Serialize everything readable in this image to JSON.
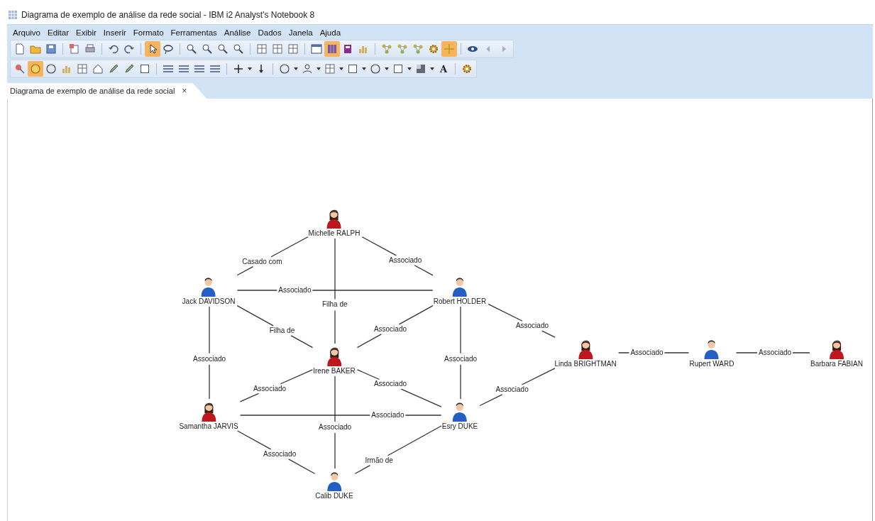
{
  "window": {
    "title": "Diagrama de exemplo de análise da rede social - IBM i2 Analyst's Notebook 8"
  },
  "menu": [
    "Arquivo",
    "Editar",
    "Exibir",
    "Inserir",
    "Formato",
    "Ferramentas",
    "Análise",
    "Dados",
    "Janela",
    "Ajuda"
  ],
  "toolbar_1": [
    {
      "selected": false
    },
    {
      "selected": false
    },
    {
      "selected": false
    },
    {
      "selected": false
    },
    {
      "selected": false
    },
    {
      "selected": false
    },
    {
      "selected": false
    },
    {
      "selected": true
    },
    {
      "selected": false
    },
    {
      "selected": false
    },
    {
      "selected": false
    },
    {
      "selected": false
    },
    {
      "selected": false
    },
    {
      "selected": false
    },
    {
      "selected": false
    },
    {
      "selected": false
    },
    {
      "selected": false
    },
    {
      "selected": true
    },
    {
      "selected": false
    },
    {
      "selected": false
    },
    {
      "selected": false
    },
    {
      "selected": false
    },
    {
      "selected": false
    },
    {
      "selected": false
    },
    {
      "selected": true
    },
    {
      "selected": false
    },
    {
      "selected": false
    },
    {
      "selected": false
    }
  ],
  "toolbar_2": [
    {
      "selected": false
    },
    {
      "selected": true
    },
    {
      "selected": false
    },
    {
      "selected": false
    },
    {
      "selected": false
    },
    {
      "selected": false
    },
    {
      "selected": false
    },
    {
      "selected": false
    },
    {
      "selected": false
    },
    {
      "selected": false
    },
    {
      "selected": false
    },
    {
      "selected": false
    },
    {
      "selected": false
    },
    {
      "selected": false
    },
    {
      "selected": false
    },
    {
      "selected": false
    },
    {
      "selected": false
    },
    {
      "selected": false
    },
    {
      "selected": false
    },
    {
      "selected": false
    },
    {
      "selected": false
    },
    {
      "selected": false
    },
    {
      "selected": false
    },
    {
      "selected": false
    },
    {
      "selected": false
    },
    {
      "selected": false
    },
    {
      "selected": false
    },
    {
      "selected": false
    },
    {
      "selected": false
    },
    {
      "selected": false
    },
    {
      "selected": false,
      "text": "A"
    },
    {
      "selected": false
    }
  ],
  "tabs": [
    {
      "label": "Diagrama de exemplo de análise da rede social",
      "close": "×",
      "selected": true
    }
  ],
  "chart": {
    "nodes": [
      {
        "name": "Michelle RALPH",
        "kind": "female"
      },
      {
        "name": "Jack DAVIDSON",
        "kind": "male"
      },
      {
        "name": "Robert HOLDER",
        "kind": "male"
      },
      {
        "name": "Irene BAKER",
        "kind": "female"
      },
      {
        "name": "Samantha JARVIS",
        "kind": "female"
      },
      {
        "name": "Esry DUKE",
        "kind": "male"
      },
      {
        "name": "Calib DUKE",
        "kind": "male"
      },
      {
        "name": "Linda BRIGHTMAN",
        "kind": "female"
      },
      {
        "name": "Rupert WARD",
        "kind": "male"
      },
      {
        "name": "Barbara FABIAN",
        "kind": "female"
      }
    ],
    "links": [
      {
        "label": "Casado com"
      },
      {
        "label": "Associado"
      },
      {
        "label": "Filha de"
      },
      {
        "label": "Associado"
      },
      {
        "label": "Filha de"
      },
      {
        "label": "Associado"
      },
      {
        "label": "Associado"
      },
      {
        "label": "Associado"
      },
      {
        "label": "Associado"
      },
      {
        "label": "Associado"
      },
      {
        "label": "Associado"
      },
      {
        "label": "Associado"
      },
      {
        "label": "Associado"
      },
      {
        "label": "Associado"
      },
      {
        "label": "Irmão de"
      },
      {
        "label": "Associado"
      },
      {
        "label": "Associado"
      },
      {
        "label": "Associado"
      }
    ]
  }
}
